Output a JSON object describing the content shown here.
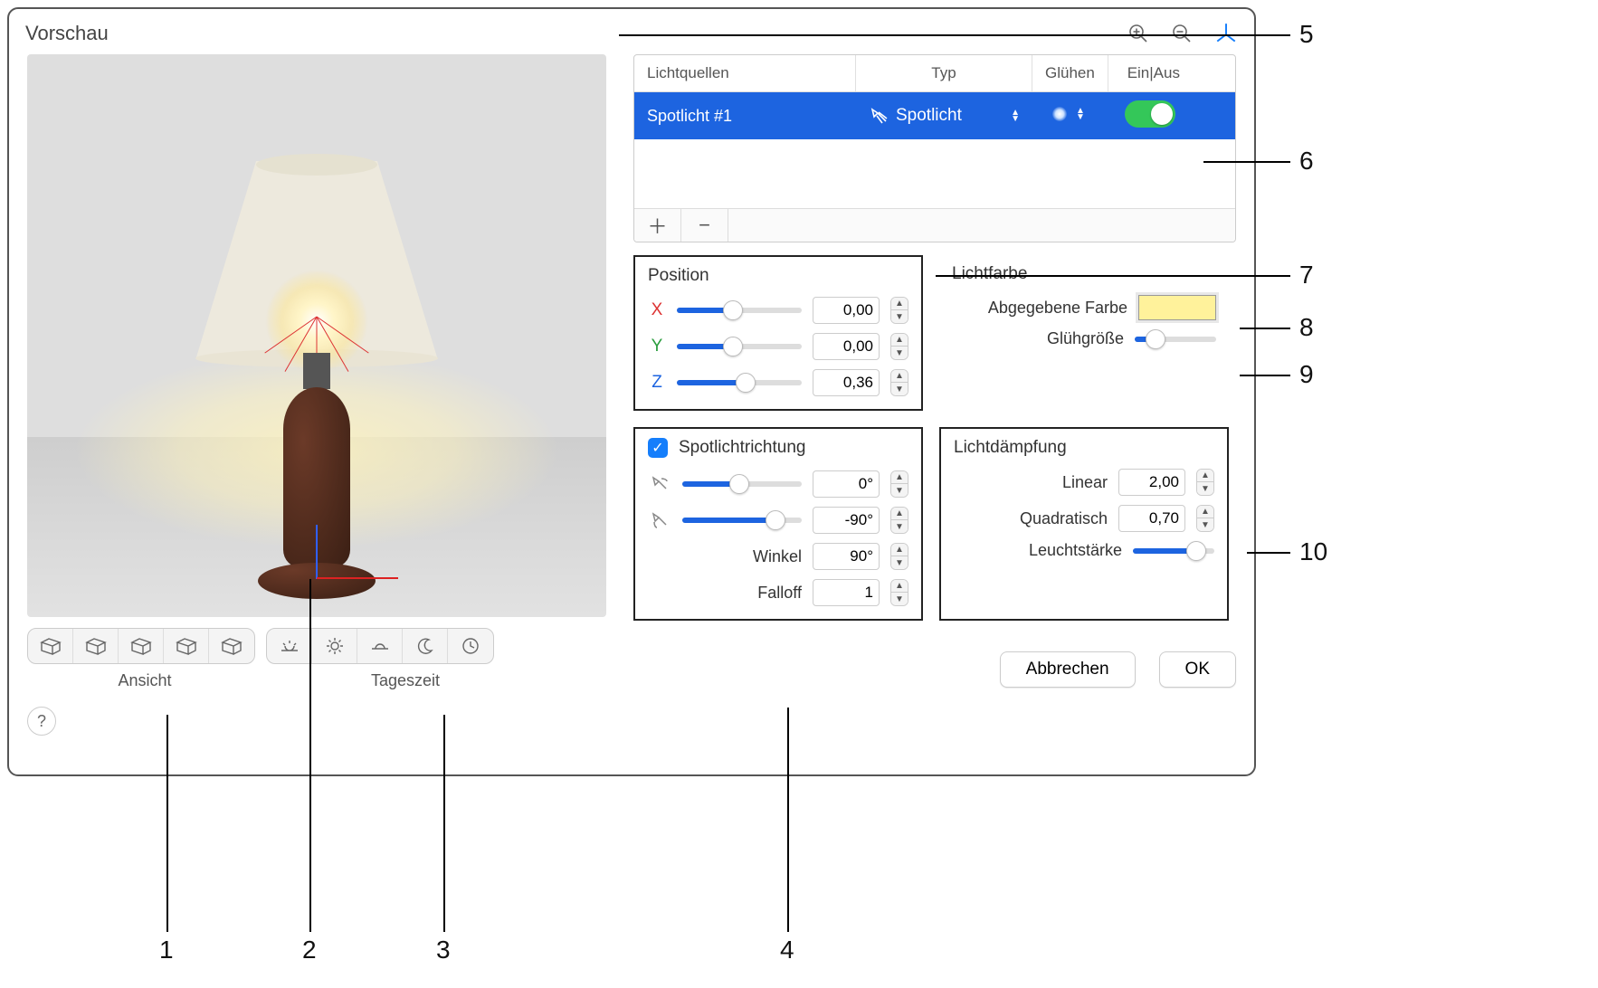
{
  "titlebar": {
    "title": "Vorschau"
  },
  "table": {
    "headers": {
      "name": "Lichtquellen",
      "type": "Typ",
      "glow": "Glühen",
      "on": "Ein|Aus"
    },
    "row": {
      "name": "Spotlicht #1",
      "type": "Spotlicht"
    }
  },
  "position": {
    "title": "Position",
    "x": {
      "label": "X",
      "value": "0,00",
      "pct": 45
    },
    "y": {
      "label": "Y",
      "value": "0,00",
      "pct": 45
    },
    "z": {
      "label": "Z",
      "value": "0,36",
      "pct": 55
    }
  },
  "lichtfarbe": {
    "title": "Lichtfarbe",
    "emit_label": "Abgegebene Farbe",
    "glow_label": "Glühgröße",
    "glow_pct": 25
  },
  "spot": {
    "title": "Spotlichtrichtung",
    "rot1": {
      "value": "0°",
      "pct": 48
    },
    "rot2": {
      "value": "-90°",
      "pct": 78
    },
    "angle_label": "Winkel",
    "angle_value": "90°",
    "falloff_label": "Falloff",
    "falloff_value": "1"
  },
  "att": {
    "title": "Lichtdämpfung",
    "linear_label": "Linear",
    "linear_value": "2,00",
    "quad_label": "Quadratisch",
    "quad_value": "0,70",
    "lum_label": "Leuchtstärke",
    "lum_pct": 78
  },
  "buttons": {
    "cancel": "Abbrechen",
    "ok": "OK"
  },
  "viewbar": {
    "ansicht": "Ansicht",
    "tageszeit": "Tageszeit"
  },
  "annotations": {
    "n1": "1",
    "n2": "2",
    "n3": "3",
    "n4": "4",
    "n5": "5",
    "n6": "6",
    "n7": "7",
    "n8": "8",
    "n9": "9",
    "n10": "10"
  }
}
